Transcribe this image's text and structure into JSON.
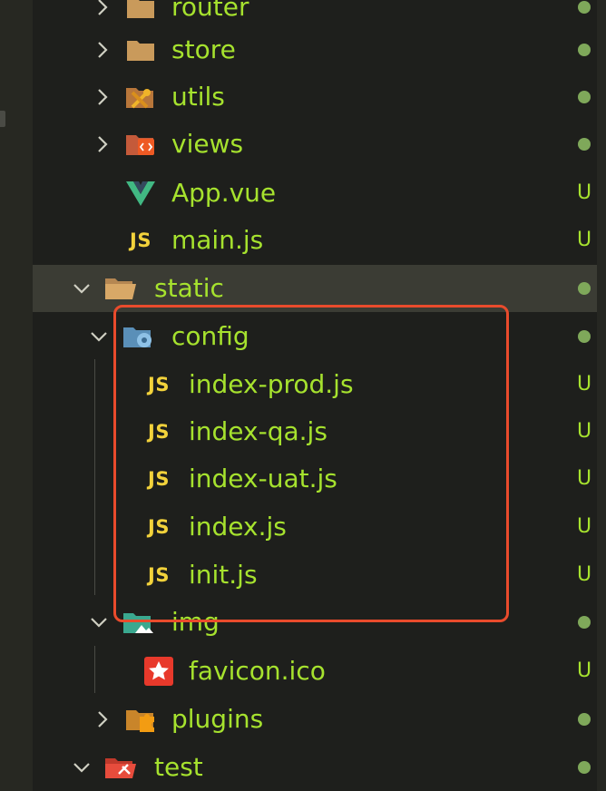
{
  "explorer": {
    "rows": [
      {
        "label": "router",
        "status": "dot"
      },
      {
        "label": "store",
        "status": "dot"
      },
      {
        "label": "utils",
        "status": "dot"
      },
      {
        "label": "views",
        "status": "dot"
      },
      {
        "label": "App.vue",
        "status": "U"
      },
      {
        "label": "main.js",
        "status": "U"
      },
      {
        "label": "static",
        "status": "dot"
      },
      {
        "label": "config",
        "status": "dot"
      },
      {
        "label": "index-prod.js",
        "status": "U"
      },
      {
        "label": "index-qa.js",
        "status": "U"
      },
      {
        "label": "index-uat.js",
        "status": "U"
      },
      {
        "label": "index.js",
        "status": "U"
      },
      {
        "label": "init.js",
        "status": "U"
      },
      {
        "label": "img",
        "status": "dot"
      },
      {
        "label": "favicon.ico",
        "status": "U"
      },
      {
        "label": "plugins",
        "status": "dot"
      },
      {
        "label": "test",
        "status": "dot"
      }
    ],
    "js_badge": "JS",
    "selected_row": "static",
    "highlighted_group": "config"
  },
  "colors": {
    "background": "#1e1f1c",
    "label": "#a6e22e",
    "js_badge": "#f2d23b",
    "status_dot": "#7fa85a",
    "highlight_border": "#e94b2c",
    "selected_row": "#3b3c34"
  },
  "icons": {
    "router": "folder-icon",
    "store": "folder-icon",
    "utils": "utils-folder-icon",
    "views": "views-folder-icon",
    "App.vue": "vue-icon",
    "main.js": "js-file-icon",
    "static": "folder-open-icon",
    "config": "config-folder-icon",
    "img": "image-folder-icon",
    "favicon.ico": "favicon-icon",
    "plugins": "plugins-folder-icon",
    "test": "test-folder-icon"
  }
}
